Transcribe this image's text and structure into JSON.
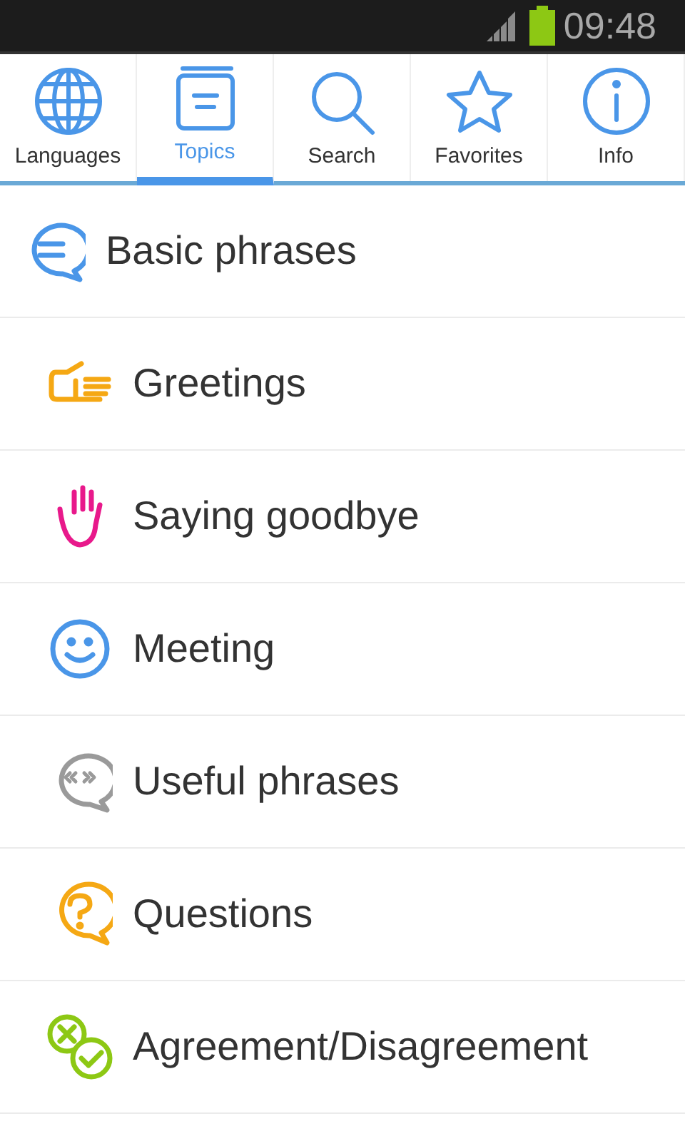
{
  "status_bar": {
    "time": "09:48"
  },
  "tabs": [
    {
      "label": "Languages",
      "selected": false
    },
    {
      "label": "Topics",
      "selected": true
    },
    {
      "label": "Search",
      "selected": false
    },
    {
      "label": "Favorites",
      "selected": false
    },
    {
      "label": "Info",
      "selected": false
    }
  ],
  "section": {
    "title": "Basic phrases"
  },
  "topics": [
    {
      "label": "Greetings"
    },
    {
      "label": "Saying goodbye"
    },
    {
      "label": "Meeting"
    },
    {
      "label": "Useful phrases"
    },
    {
      "label": "Questions"
    },
    {
      "label": "Agreement/Disagreement"
    }
  ]
}
